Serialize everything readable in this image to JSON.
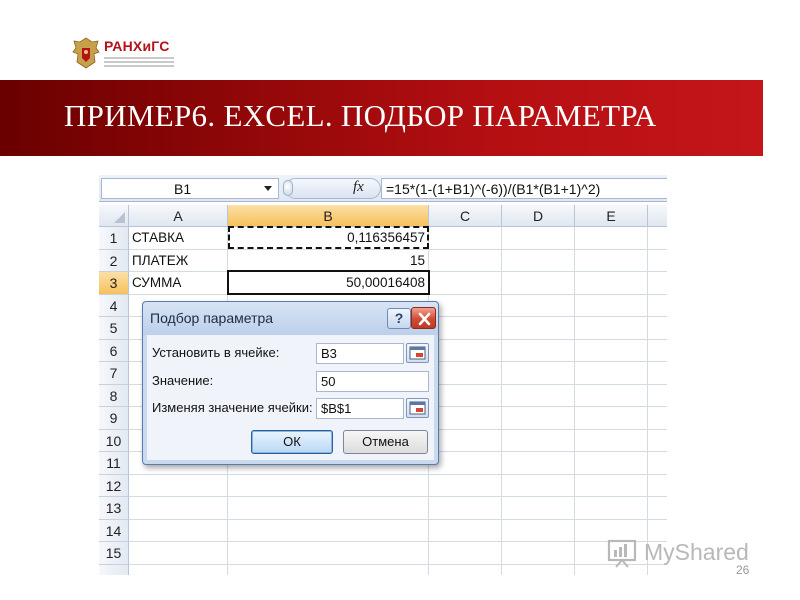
{
  "logo": {
    "name": "РАНХиГС"
  },
  "slide": {
    "title": "ПРИМЕР6. EXCEL. ПОДБОР ПАРАМЕТРА",
    "page_number": "26"
  },
  "excel": {
    "name_box": "B1",
    "formula": "=15*(1-(1+B1)^(-6))/(B1*(B1+1)^2)",
    "columns": [
      "A",
      "B",
      "C",
      "D",
      "E"
    ],
    "rows": [
      "1",
      "2",
      "3",
      "4",
      "5",
      "6",
      "7",
      "8",
      "9",
      "10",
      "11",
      "12",
      "13",
      "14",
      "15"
    ],
    "cells": {
      "A1": "СТАВКА",
      "B1": "0,116356457",
      "A2": "ПЛАТЕЖ",
      "B2": "15",
      "A3": "СУММА",
      "B3": "50,00016408"
    }
  },
  "dialog": {
    "title": "Подбор параметра",
    "help": "?",
    "set_cell_label": "Установить в ячейке:",
    "set_cell_value": "B3",
    "value_label": "Значение:",
    "value_value": "50",
    "changing_label": "Изменяя значение ячейки:",
    "changing_value": "$B$1",
    "ok": "ОК",
    "cancel": "Отмена"
  },
  "watermark": {
    "text": "MyShared"
  },
  "colors": {
    "title_band": "#b50f12",
    "excel_header": "#e1e7f0",
    "active_header": "#f6c15b"
  }
}
